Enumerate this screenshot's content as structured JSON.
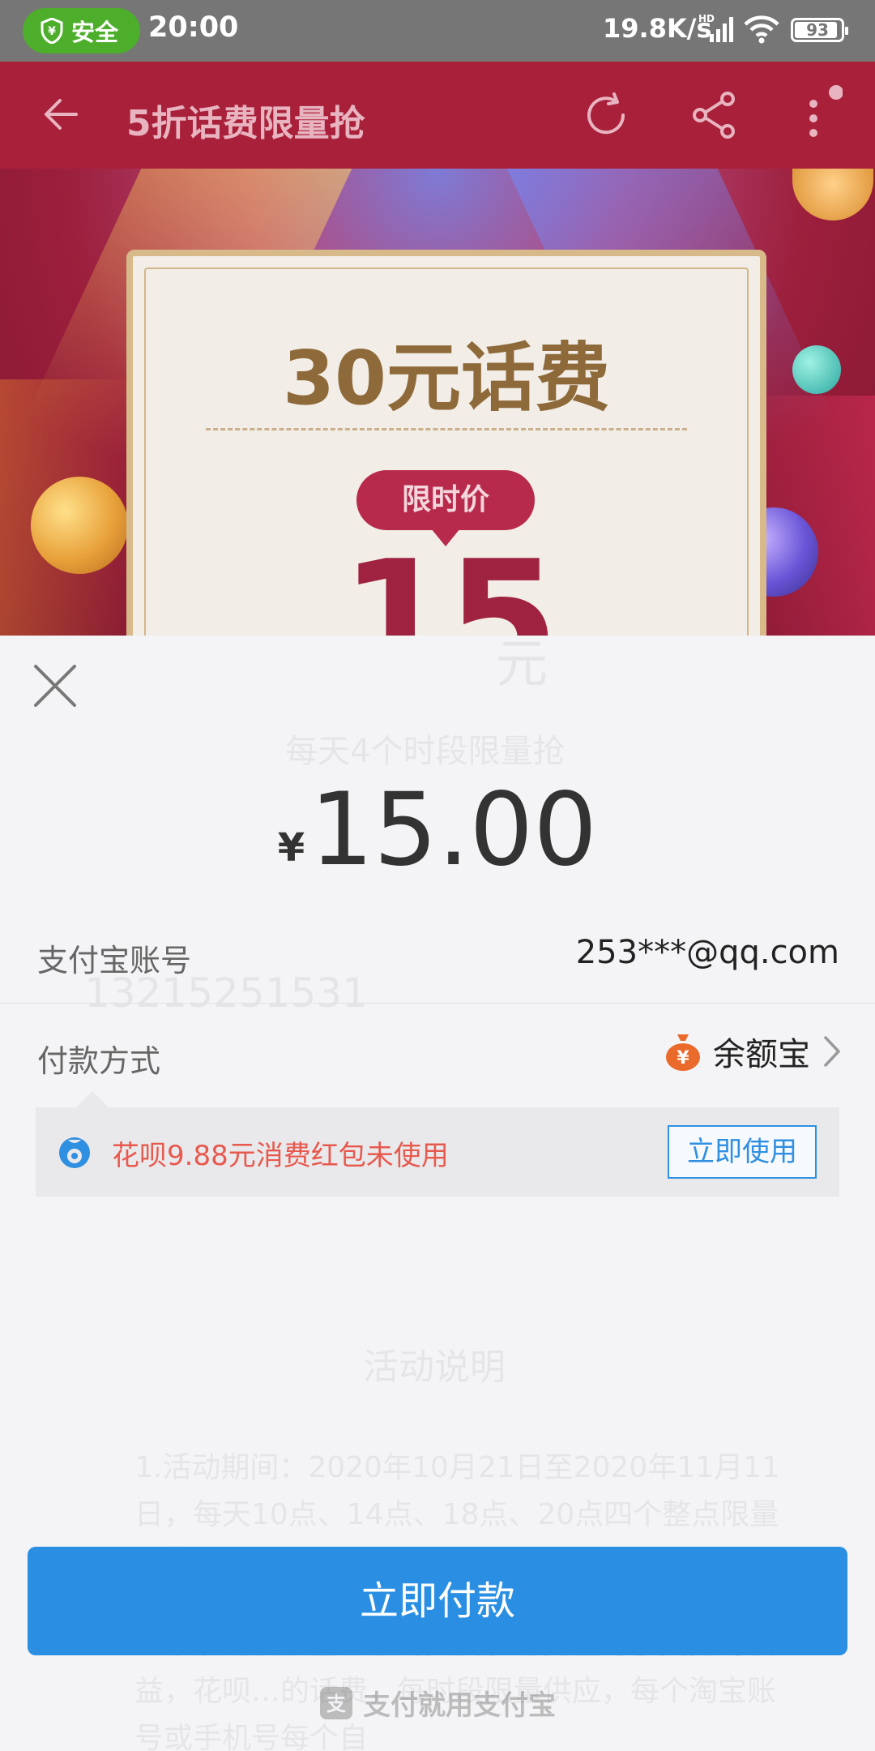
{
  "status_bar": {
    "secure_label": "安全",
    "time": "20:00",
    "net_speed": "19.8K/s",
    "network_type": "HD",
    "battery_level": "93"
  },
  "header": {
    "title": "5折话费限量抢"
  },
  "banner": {
    "title": "30元话费",
    "tag": "限时价",
    "price": "15",
    "price_unit": "元",
    "subtitle": "每天4个时段限量抢"
  },
  "background_page": {
    "phone_number": "13215251531",
    "section_title": "活动说明",
    "rule_1": "1.活动期间：2020年10月21日至2020年11月11日，每天10点、14点、18点、20点四个整点限量开抢。",
    "rule_2": "2.本活动仅限在本活动页面参与充值时享受抢购权益，花呗…的话费，每时段限量供应，每个淘宝账号或手机号每个自"
  },
  "payment": {
    "currency_symbol": "¥",
    "amount": "15.00",
    "account_label": "支付宝账号",
    "account_value": "253***@qq.com",
    "method_label": "付款方式",
    "method_value": "余额宝",
    "promo_text": "花呗9.88元消费红包未使用",
    "promo_button": "立即使用",
    "pay_button": "立即付款",
    "footer_text": "支付就用支付宝"
  },
  "colors": {
    "status_bar": "#767676",
    "secure_green": "#4cae2b",
    "header_red": "#a8203a",
    "pay_blue": "#2a8fe3",
    "promo_red": "#e8594d",
    "balance_orange": "#e96a2a"
  }
}
